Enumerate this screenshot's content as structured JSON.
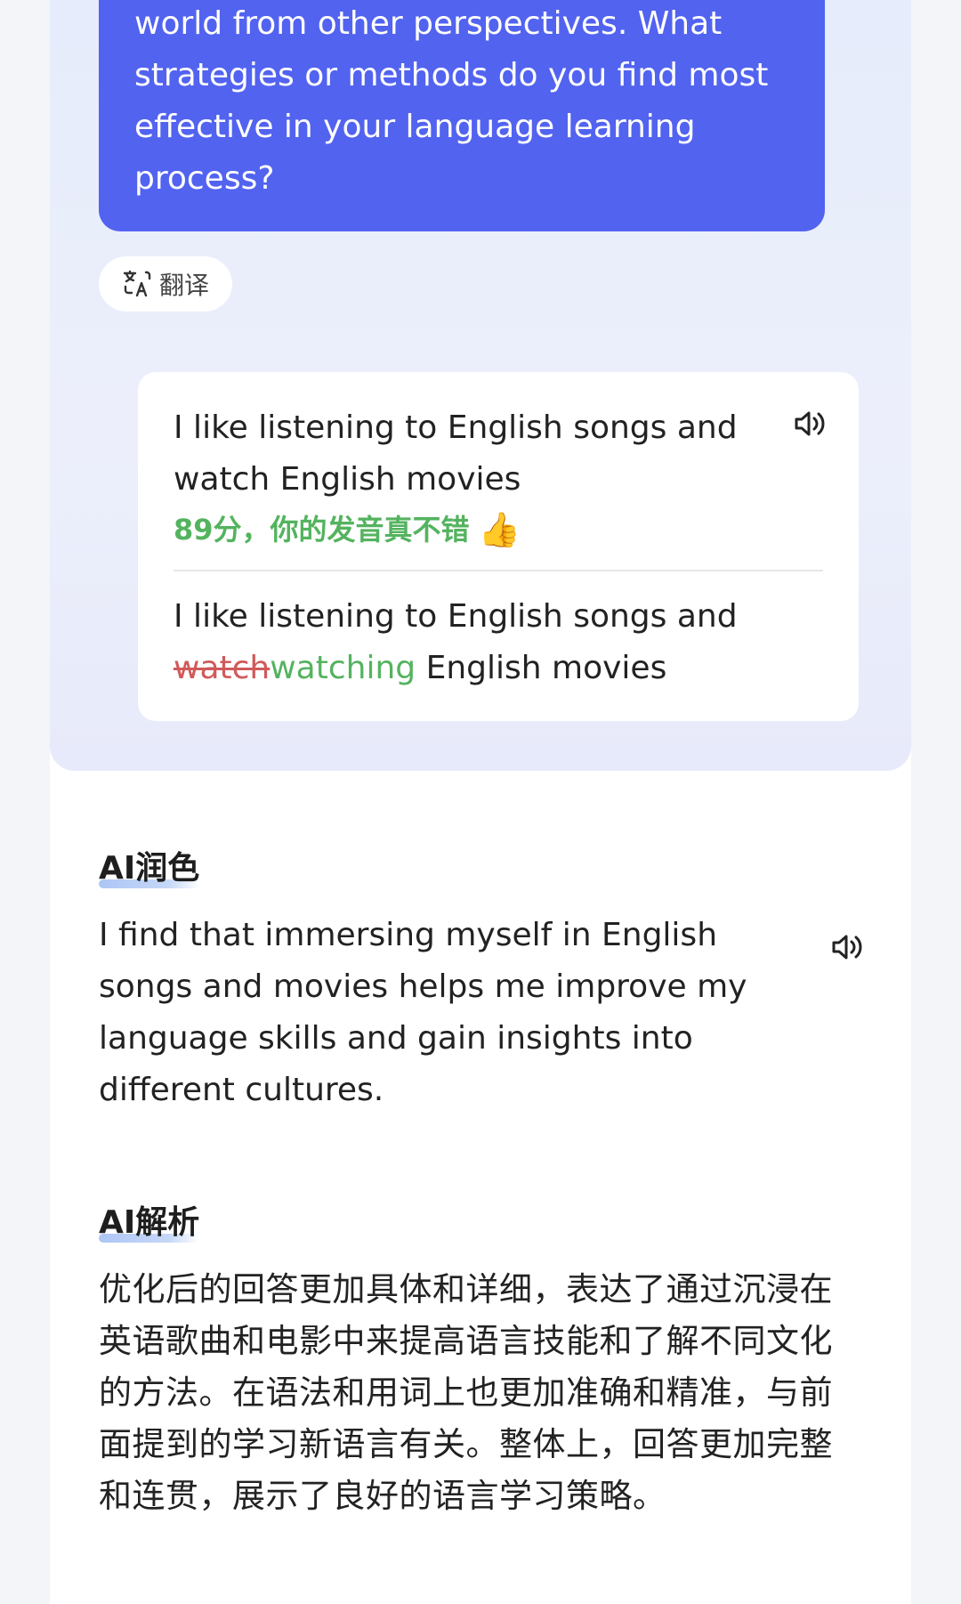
{
  "ai_message": {
    "text": "world from other perspectives. What strategies or methods do you find most effective in your language learning process?"
  },
  "translate_button": {
    "label": "翻译",
    "icon": "translate-icon"
  },
  "user_message": {
    "text": "I like listening to English songs and watch English movies",
    "score_text": "89分，你的发音真不错",
    "score_emoji": "👍",
    "correction": {
      "prefix": "I like listening to English songs and ",
      "wrong": "watch",
      "right": "watching",
      "suffix": " English movies"
    },
    "speaker_icon": "speaker-icon"
  },
  "polish": {
    "title": "AI润色",
    "text": "I find that immersing myself in English songs and movies helps me improve my language skills and gain insights into different cultures.",
    "speaker_icon": "speaker-icon"
  },
  "analysis": {
    "title": "AI解析",
    "text": "优化后的回答更加具体和详细，表达了通过沉浸在英语歌曲和电影中来提高语言技能和了解不同文化的方法。在语法和用词上也更加准确和精准，与前面提到的学习新语言有关。整体上，回答更加完整和连贯，展示了良好的语言学习策略。"
  },
  "colors": {
    "accent": "#5263f0",
    "correct": "#54b35f",
    "wrong": "#d05a5a",
    "background": "#f4f5f8"
  }
}
